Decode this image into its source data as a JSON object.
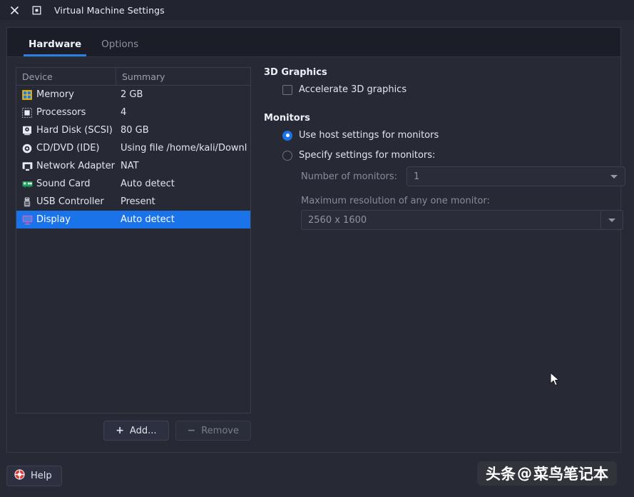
{
  "titlebar": {
    "close_icon": "close-icon",
    "maximize_icon": "maximize-icon",
    "title": "Virtual Machine Settings"
  },
  "tabs": [
    {
      "label": "Hardware",
      "active": true
    },
    {
      "label": "Options",
      "active": false
    }
  ],
  "device_list": {
    "columns": {
      "device": "Device",
      "summary": "Summary"
    },
    "rows": [
      {
        "icon": "memory-icon",
        "device": "Memory",
        "summary": "2 GB"
      },
      {
        "icon": "processors-icon",
        "device": "Processors",
        "summary": "4"
      },
      {
        "icon": "hard-disk-icon",
        "device": "Hard Disk (SCSI)",
        "summary": "80 GB"
      },
      {
        "icon": "cd-dvd-icon",
        "device": "CD/DVD (IDE)",
        "summary": "Using file /home/kali/Downl"
      },
      {
        "icon": "network-adapter-icon",
        "device": "Network Adapter",
        "summary": "NAT"
      },
      {
        "icon": "sound-card-icon",
        "device": "Sound Card",
        "summary": "Auto detect"
      },
      {
        "icon": "usb-controller-icon",
        "device": "USB Controller",
        "summary": "Present"
      },
      {
        "icon": "display-icon",
        "device": "Display",
        "summary": "Auto detect",
        "selected": true
      }
    ],
    "add_label": "Add...",
    "add_symbol": "+",
    "remove_label": "Remove",
    "remove_symbol": "−"
  },
  "panel": {
    "graphics_group_title": "3D Graphics",
    "accelerate_label": "Accelerate 3D graphics",
    "accelerate_checked": false,
    "monitors_group_title": "Monitors",
    "use_host_label": "Use host settings for monitors",
    "use_host_selected": true,
    "specify_label": "Specify settings for monitors:",
    "specify_selected": false,
    "number_of_monitors_label": "Number of monitors:",
    "number_of_monitors_value": "1",
    "max_resolution_label": "Maximum resolution of any one monitor:",
    "max_resolution_value": "2560 x 1600"
  },
  "footer": {
    "help_label": "Help",
    "help_icon": "lifebuoy-icon"
  },
  "watermark": {
    "prefix": "头条",
    "at": "@",
    "name": "菜鸟笔记本"
  },
  "colors": {
    "window_bg": "#272a35",
    "titlebar_bg": "#22252f",
    "tabstrip_bg": "#1b1e26",
    "accent": "#1a73e8",
    "tab_underline": "#2b7fe0",
    "border": "#3a3e4a",
    "muted_text": "#868c99"
  }
}
